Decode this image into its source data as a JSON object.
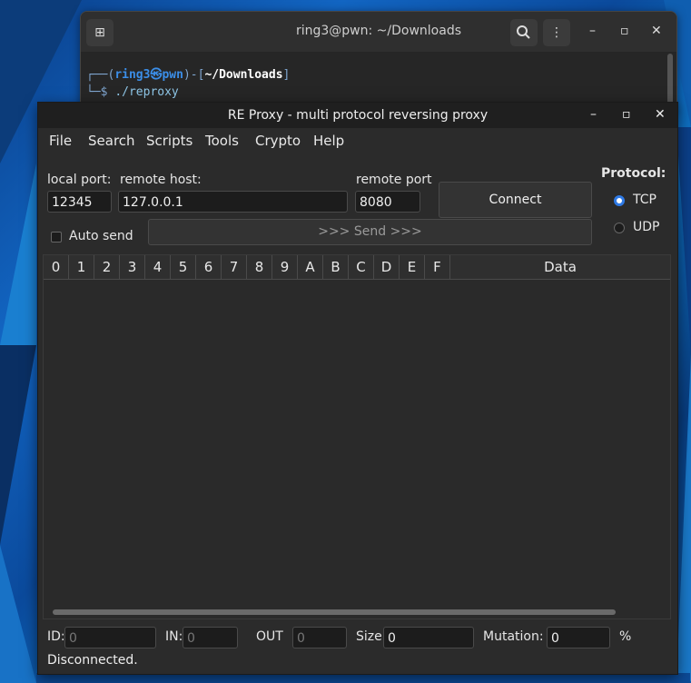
{
  "terminal": {
    "title": "ring3@pwn: ~/Downloads",
    "prompt_user": "ring3",
    "prompt_at": "㉿",
    "prompt_host": "pwn",
    "prompt_path": "~/Downloads",
    "command": "./reproxy",
    "line1_prefix": "┌──(",
    "line1_mid": ")-[",
    "line1_end": "]",
    "line2_prefix": "└─$ "
  },
  "proxy": {
    "title": "RE Proxy - multi protocol reversing proxy",
    "menu": [
      "File",
      "Search",
      "Scripts",
      "Tools",
      "Crypto",
      "Help"
    ],
    "local_port_label": "local port:",
    "local_port_value": "12345",
    "remote_host_label": "remote host:",
    "remote_host_value": "127.0.0.1",
    "remote_port_label": "remote port",
    "remote_port_value": "8080",
    "connect_label": "Connect",
    "protocol_label": "Protocol:",
    "protocol_options": [
      "TCP",
      "UDP"
    ],
    "protocol_selected": "TCP",
    "auto_send_label": "Auto send",
    "send_label": ">>> Send >>>",
    "grid_headers": [
      "0",
      "1",
      "2",
      "3",
      "4",
      "5",
      "6",
      "7",
      "8",
      "9",
      "A",
      "B",
      "C",
      "D",
      "E",
      "F",
      "Data"
    ],
    "id_label": "ID:",
    "id_value": "0",
    "in_label": "IN:",
    "in_value": "0",
    "out_label": "OUT",
    "out_value": "0",
    "size_label": "Size:",
    "size_value": "0",
    "mutation_label": "Mutation:",
    "mutation_value": "0",
    "percent": "%",
    "status": "Disconnected."
  },
  "colors": {
    "accent": "#2f7ae5",
    "window_bg": "#2b2b2b",
    "titlebar": "#1f1f1f"
  }
}
